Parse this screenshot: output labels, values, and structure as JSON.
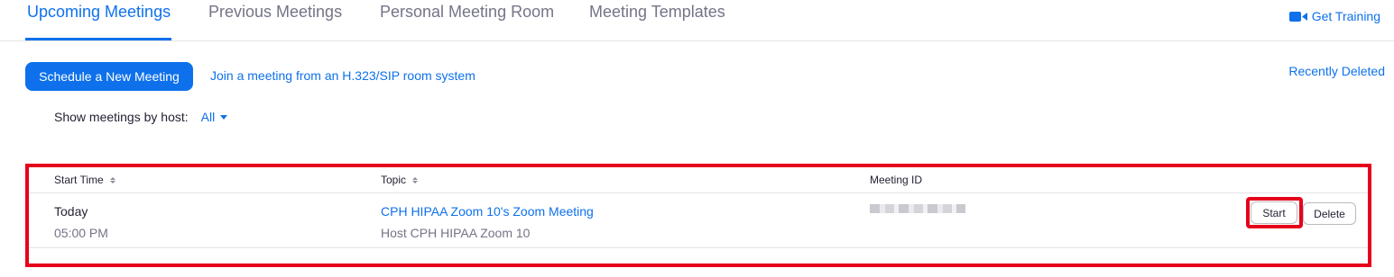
{
  "tabs": [
    {
      "label": "Upcoming Meetings",
      "active": true
    },
    {
      "label": "Previous Meetings",
      "active": false
    },
    {
      "label": "Personal Meeting Room",
      "active": false
    },
    {
      "label": "Meeting Templates",
      "active": false
    }
  ],
  "get_training": {
    "label": "Get Training",
    "icon": "video-camera-icon"
  },
  "actions": {
    "schedule_button": "Schedule a New Meeting",
    "join_link": "Join a meeting from an H.323/SIP room system",
    "recently_deleted": "Recently Deleted"
  },
  "filter": {
    "label": "Show meetings by host:",
    "value": "All"
  },
  "table": {
    "columns": [
      "Start Time",
      "Topic",
      "Meeting ID"
    ],
    "rows": [
      {
        "date": "Today",
        "time": "05:00 PM",
        "topic": "CPH HIPAA Zoom 10's Zoom Meeting",
        "host": "Host CPH HIPAA Zoom 10",
        "meeting_id": "",
        "start_label": "Start",
        "delete_label": "Delete"
      }
    ]
  },
  "colors": {
    "accent": "#0e71eb",
    "highlight": "#e6001b",
    "text": "#232333",
    "muted": "#747487"
  }
}
